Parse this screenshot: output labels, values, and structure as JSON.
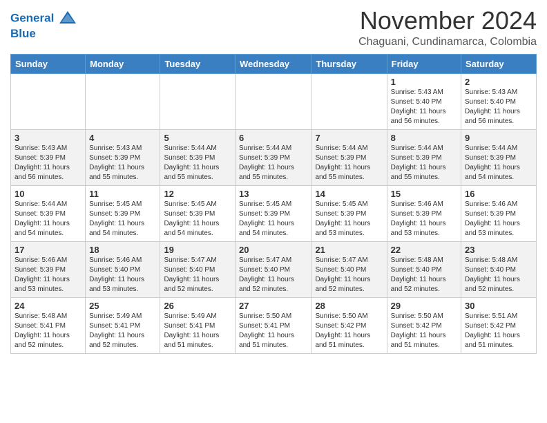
{
  "logo": {
    "line1": "General",
    "line2": "Blue"
  },
  "title": "November 2024",
  "subtitle": "Chaguani, Cundinamarca, Colombia",
  "days_of_week": [
    "Sunday",
    "Monday",
    "Tuesday",
    "Wednesday",
    "Thursday",
    "Friday",
    "Saturday"
  ],
  "weeks": [
    [
      {
        "day": "",
        "detail": ""
      },
      {
        "day": "",
        "detail": ""
      },
      {
        "day": "",
        "detail": ""
      },
      {
        "day": "",
        "detail": ""
      },
      {
        "day": "",
        "detail": ""
      },
      {
        "day": "1",
        "detail": "Sunrise: 5:43 AM\nSunset: 5:40 PM\nDaylight: 11 hours\nand 56 minutes."
      },
      {
        "day": "2",
        "detail": "Sunrise: 5:43 AM\nSunset: 5:40 PM\nDaylight: 11 hours\nand 56 minutes."
      }
    ],
    [
      {
        "day": "3",
        "detail": "Sunrise: 5:43 AM\nSunset: 5:39 PM\nDaylight: 11 hours\nand 56 minutes."
      },
      {
        "day": "4",
        "detail": "Sunrise: 5:43 AM\nSunset: 5:39 PM\nDaylight: 11 hours\nand 55 minutes."
      },
      {
        "day": "5",
        "detail": "Sunrise: 5:44 AM\nSunset: 5:39 PM\nDaylight: 11 hours\nand 55 minutes."
      },
      {
        "day": "6",
        "detail": "Sunrise: 5:44 AM\nSunset: 5:39 PM\nDaylight: 11 hours\nand 55 minutes."
      },
      {
        "day": "7",
        "detail": "Sunrise: 5:44 AM\nSunset: 5:39 PM\nDaylight: 11 hours\nand 55 minutes."
      },
      {
        "day": "8",
        "detail": "Sunrise: 5:44 AM\nSunset: 5:39 PM\nDaylight: 11 hours\nand 55 minutes."
      },
      {
        "day": "9",
        "detail": "Sunrise: 5:44 AM\nSunset: 5:39 PM\nDaylight: 11 hours\nand 54 minutes."
      }
    ],
    [
      {
        "day": "10",
        "detail": "Sunrise: 5:44 AM\nSunset: 5:39 PM\nDaylight: 11 hours\nand 54 minutes."
      },
      {
        "day": "11",
        "detail": "Sunrise: 5:45 AM\nSunset: 5:39 PM\nDaylight: 11 hours\nand 54 minutes."
      },
      {
        "day": "12",
        "detail": "Sunrise: 5:45 AM\nSunset: 5:39 PM\nDaylight: 11 hours\nand 54 minutes."
      },
      {
        "day": "13",
        "detail": "Sunrise: 5:45 AM\nSunset: 5:39 PM\nDaylight: 11 hours\nand 54 minutes."
      },
      {
        "day": "14",
        "detail": "Sunrise: 5:45 AM\nSunset: 5:39 PM\nDaylight: 11 hours\nand 53 minutes."
      },
      {
        "day": "15",
        "detail": "Sunrise: 5:46 AM\nSunset: 5:39 PM\nDaylight: 11 hours\nand 53 minutes."
      },
      {
        "day": "16",
        "detail": "Sunrise: 5:46 AM\nSunset: 5:39 PM\nDaylight: 11 hours\nand 53 minutes."
      }
    ],
    [
      {
        "day": "17",
        "detail": "Sunrise: 5:46 AM\nSunset: 5:39 PM\nDaylight: 11 hours\nand 53 minutes."
      },
      {
        "day": "18",
        "detail": "Sunrise: 5:46 AM\nSunset: 5:40 PM\nDaylight: 11 hours\nand 53 minutes."
      },
      {
        "day": "19",
        "detail": "Sunrise: 5:47 AM\nSunset: 5:40 PM\nDaylight: 11 hours\nand 52 minutes."
      },
      {
        "day": "20",
        "detail": "Sunrise: 5:47 AM\nSunset: 5:40 PM\nDaylight: 11 hours\nand 52 minutes."
      },
      {
        "day": "21",
        "detail": "Sunrise: 5:47 AM\nSunset: 5:40 PM\nDaylight: 11 hours\nand 52 minutes."
      },
      {
        "day": "22",
        "detail": "Sunrise: 5:48 AM\nSunset: 5:40 PM\nDaylight: 11 hours\nand 52 minutes."
      },
      {
        "day": "23",
        "detail": "Sunrise: 5:48 AM\nSunset: 5:40 PM\nDaylight: 11 hours\nand 52 minutes."
      }
    ],
    [
      {
        "day": "24",
        "detail": "Sunrise: 5:48 AM\nSunset: 5:41 PM\nDaylight: 11 hours\nand 52 minutes."
      },
      {
        "day": "25",
        "detail": "Sunrise: 5:49 AM\nSunset: 5:41 PM\nDaylight: 11 hours\nand 52 minutes."
      },
      {
        "day": "26",
        "detail": "Sunrise: 5:49 AM\nSunset: 5:41 PM\nDaylight: 11 hours\nand 51 minutes."
      },
      {
        "day": "27",
        "detail": "Sunrise: 5:50 AM\nSunset: 5:41 PM\nDaylight: 11 hours\nand 51 minutes."
      },
      {
        "day": "28",
        "detail": "Sunrise: 5:50 AM\nSunset: 5:42 PM\nDaylight: 11 hours\nand 51 minutes."
      },
      {
        "day": "29",
        "detail": "Sunrise: 5:50 AM\nSunset: 5:42 PM\nDaylight: 11 hours\nand 51 minutes."
      },
      {
        "day": "30",
        "detail": "Sunrise: 5:51 AM\nSunset: 5:42 PM\nDaylight: 11 hours\nand 51 minutes."
      }
    ]
  ]
}
